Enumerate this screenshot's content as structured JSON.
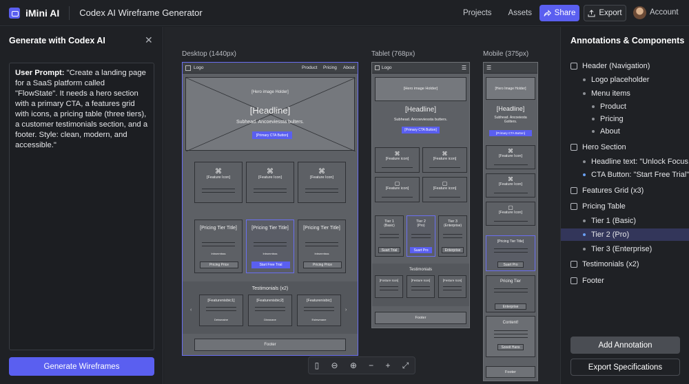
{
  "header": {
    "brand": "iMini AI",
    "title": "Codex AI Wireframe Generator",
    "nav": [
      "Projects",
      "Assets"
    ],
    "share": "Share",
    "export": "Export",
    "account": "Account"
  },
  "left": {
    "title": "Generate with Codex AI",
    "prompt_label": "User Prompt:",
    "prompt_text": " \"Create a landing page for a SaaS platform called \"FlowState\". It needs a hero section with a primary CTA, a features grid with icons, a pricing table (three tiers), a customer testimonials section, and a footer. Style: clean, modern, and accessible.\"",
    "button": "Generate Wireframes"
  },
  "canvas": {
    "labels": {
      "desktop": "Desktop (1440px)",
      "tablet": "Tablet (768px)",
      "mobile": "Mobile (375px)"
    },
    "logo": "Logo",
    "nav_items": [
      "Product",
      "Pricing",
      "About"
    ],
    "hero_image": "[Hero image Holder]",
    "headline": "[Headline]",
    "subhead": "Subhead. Ancoeviessta bulters.",
    "subhead_tablet": "Subhead. Ancoeviessta butters.",
    "subhead_mobile": "Subhead. Ancoeiesta Goliters.",
    "cta": "[Primary CTA Button]",
    "feature_icon": "[Feature Icon]",
    "feature_icon_t": "[Feature icon]",
    "pricing_title": "[Pricing Tier Title]",
    "pricing_small": "Inbsmmlsss",
    "pricing_btn1": "Pricing Price",
    "pricing_btn2": "Start Free Trial",
    "pricing_btn3": "Pricing Price",
    "testimonials_title": "Testimonials (x2)",
    "testimonials_tablet": "Testimonials",
    "testimonial_labels": [
      "[Featurenisbic1]",
      "[Featurenisbic2]",
      "[Featurenisbic]"
    ],
    "testimonial_names": [
      "Detwmaine",
      "Dinwnane",
      "Estewmane"
    ],
    "testimonial_tablet": [
      "[Fosture Icon]",
      "[Festure Icon]",
      "[Festure Icon]"
    ],
    "footer": "Footer",
    "tier_t": [
      {
        "name": "Tier 1",
        "sub": "(Basic)",
        "btn": "Suart Trial"
      },
      {
        "name": "Tier 2",
        "sub": "(Pro)",
        "btn": "Suart Pro"
      },
      {
        "name": "Tier 3",
        "sub": "(Enterprise)",
        "btn": "Enterprise"
      }
    ],
    "mobile_hero_image": "[Hero Image Holder]",
    "mobile_pricing_title": "[Pricing Tier Title]",
    "mobile_pricing_btn": "Suart Pro",
    "mobile_pricing_tier": "Pricing Tier",
    "mobile_enterprise": "Enterprise",
    "mobile_content": "Content!",
    "mobile_content_btn": "Szeeit Hans"
  },
  "right": {
    "title": "Annotations & Components",
    "items": [
      {
        "kind": "check",
        "label": "Header (Navigation)"
      },
      {
        "kind": "dot",
        "label": "Logo placeholder"
      },
      {
        "kind": "dot",
        "label": "Menu items"
      },
      {
        "kind": "dot2",
        "label": "Product"
      },
      {
        "kind": "dot2",
        "label": "Pricing"
      },
      {
        "kind": "dot2",
        "label": "About"
      },
      {
        "kind": "check",
        "label": "Hero Section"
      },
      {
        "kind": "dot",
        "label": "Headline text: \"Unlock Focus..."
      },
      {
        "kind": "dotb",
        "label": "CTA Button: \"Start Free Trial\""
      },
      {
        "kind": "check",
        "label": "Features Grid (x3)"
      },
      {
        "kind": "check",
        "label": "Pricing Table"
      },
      {
        "kind": "dot",
        "label": "Tier 1 (Basic)"
      },
      {
        "kind": "doth",
        "label": "Tier 2 (Pro)"
      },
      {
        "kind": "dot",
        "label": "Tier 3 (Enterprise)"
      },
      {
        "kind": "check",
        "label": "Testimonials (x2)"
      },
      {
        "kind": "check",
        "label": "Footer"
      }
    ],
    "add_button": "Add Annotation",
    "export_button": "Export Specifications"
  }
}
